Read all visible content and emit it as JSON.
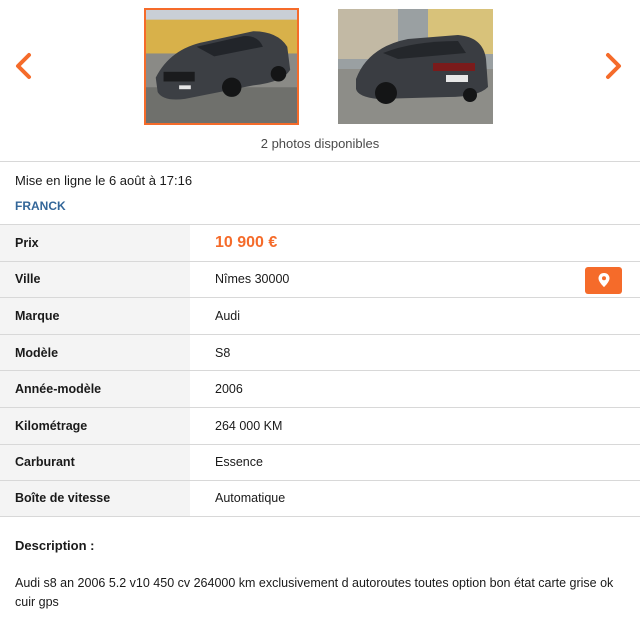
{
  "gallery": {
    "photo_count_text": "2 photos disponibles",
    "photos": [
      {
        "description": "gray sedan front three-quarter view",
        "selected": true
      },
      {
        "description": "gray sedan rear three-quarter view",
        "selected": false
      }
    ],
    "prev_icon": "chevron-left-icon",
    "next_icon": "chevron-right-icon"
  },
  "listing": {
    "posted_text": "Mise en ligne le 6 août à 17:16",
    "seller_name": "FRANCK"
  },
  "specs": [
    {
      "label": "Prix",
      "value": "10 900 €"
    },
    {
      "label": "Ville",
      "value": "Nîmes 30000"
    },
    {
      "label": "Marque",
      "value": "Audi"
    },
    {
      "label": "Modèle",
      "value": "S8"
    },
    {
      "label": "Année-modèle",
      "value": "2006"
    },
    {
      "label": "Kilométrage",
      "value": "264 000 KM"
    },
    {
      "label": "Carburant",
      "value": "Essence"
    },
    {
      "label": "Boîte de vitesse",
      "value": "Automatique"
    }
  ],
  "map_button_icon": "location-pin-icon",
  "description": {
    "title": "Description :",
    "text": "Audi s8 an 2006 5.2 v10 450 cv 264000 km exclusivement d autoroutes toutes option bon état carte grise ok cuir gps"
  },
  "colors": {
    "accent": "#f56b2a",
    "link": "#336699",
    "label_bg": "#f4f4f4",
    "divider": "#d8d8d8"
  }
}
